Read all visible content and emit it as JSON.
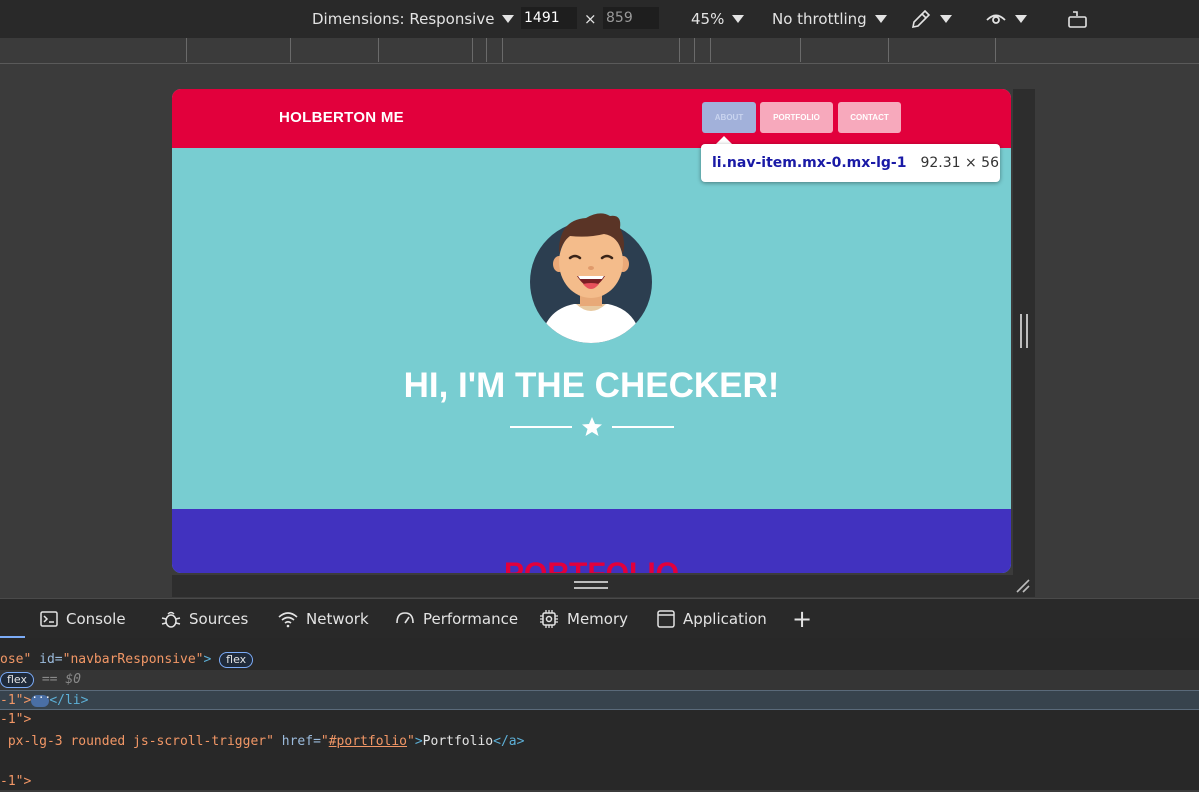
{
  "device_toolbar": {
    "dimensions_label": "Dimensions: Responsive",
    "width_value": "1491",
    "height_value": "859",
    "times_symbol": "×",
    "zoom_label": "45%",
    "throttling_label": "No throttling"
  },
  "site": {
    "brand": "HOLBERTON ME",
    "nav_items": [
      "ABOUT",
      "PORTFOLIO",
      "CONTACT"
    ],
    "hero_title": "HI, I'M THE CHECKER!",
    "portfolio_heading": "PORTFOLIO",
    "colors": {
      "navbar": "#e2003c",
      "masthead": "#78cdd1",
      "portfolio_section": "#4132bf",
      "nav_button": "#f7a9bc",
      "nav_button_highlight": "#a2b1da"
    }
  },
  "tooltip": {
    "selector": "li.nav-item.mx-0.mx-lg-1",
    "size": "92.31 × 56"
  },
  "devtools": {
    "tabs": [
      "Console",
      "Sources",
      "Network",
      "Performance",
      "Memory",
      "Application"
    ],
    "add_tab_symbol": "+",
    "code": {
      "line1_prefix": "ose\"",
      "line1_attr": "id",
      "line1_value": "\"navbarResponsive\"",
      "line1_badge": "flex",
      "line2_badge": "flex",
      "line2_dollar": "== $0",
      "line3_prefix": "-1\">",
      "line3_close": "</li>",
      "line4_prefix": "-1\">",
      "line5_prefix": " px-lg-3 rounded js-scroll-trigger\"",
      "line5_attr": "href",
      "line5_value": "#portfolio",
      "line5_text": "Portfolio",
      "line5_close": "</a>",
      "line7_prefix": "-1\">"
    }
  }
}
